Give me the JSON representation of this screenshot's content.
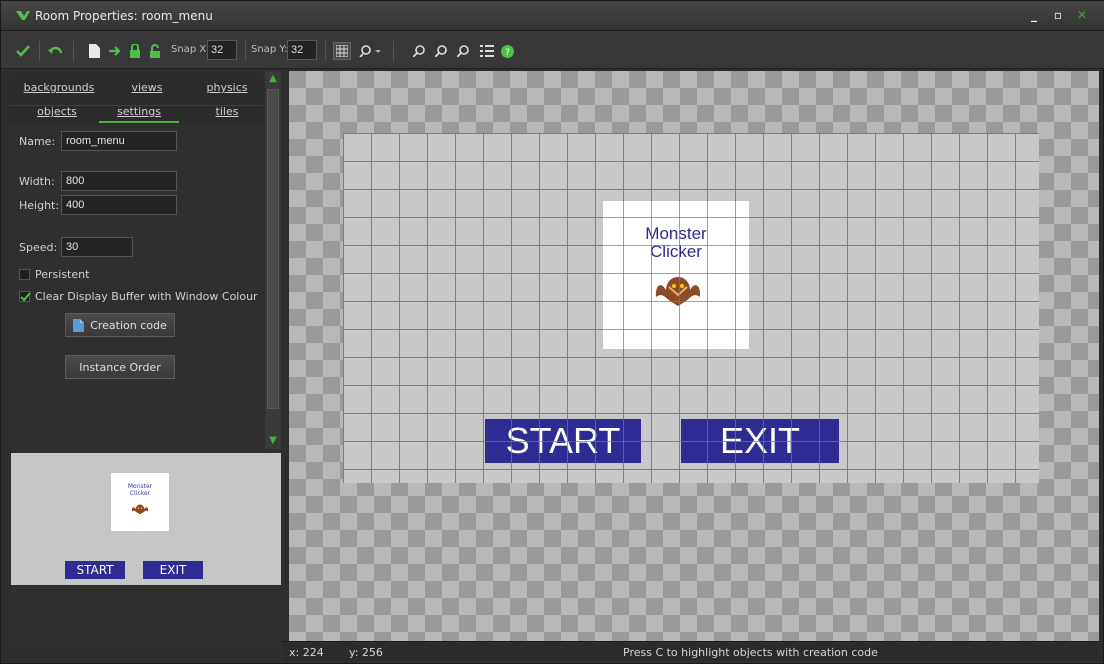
{
  "window": {
    "title": "Room Properties: room_menu",
    "controls": {
      "minimize": "_",
      "maximize": "▫",
      "close": "✕"
    }
  },
  "toolbar": {
    "snap_x_label": "Snap X:",
    "snap_x_value": "32",
    "snap_y_label": "Snap Y:",
    "snap_y_value": "32",
    "icons": [
      "ok-check-icon",
      "undo-icon",
      "new-icon",
      "shift-icon",
      "lock-icon",
      "unlock-icon",
      "grid-icon",
      "zoom-dropdown-icon",
      "zoom-out-icon",
      "zoom-reset-icon",
      "zoom-in-icon",
      "list-icon",
      "help-icon"
    ]
  },
  "tabs": [
    {
      "label": "backgrounds",
      "active": false
    },
    {
      "label": "views",
      "active": false
    },
    {
      "label": "physics",
      "active": false
    },
    {
      "label": "objects",
      "active": false
    },
    {
      "label": "settings",
      "active": true
    },
    {
      "label": "tiles",
      "active": false
    }
  ],
  "settings": {
    "name_label": "Name:",
    "name_value": "room_menu",
    "width_label": "Width:",
    "width_value": "800",
    "height_label": "Height:",
    "height_value": "400",
    "speed_label": "Speed:",
    "speed_value": "30",
    "persistent_label": "Persistent",
    "persistent_checked": false,
    "clear_display_label": "Clear Display Buffer with Window Colour",
    "clear_display_checked": true,
    "creation_code_button": "Creation code",
    "instance_order_button": "Instance Order"
  },
  "preview": {
    "logo_line1": "Monster",
    "logo_line2": "Clicker",
    "start_label": "START",
    "exit_label": "EXIT"
  },
  "room": {
    "logo_line1": "Monster",
    "logo_line2": "Clicker",
    "start_label": "START",
    "exit_label": "EXIT"
  },
  "status": {
    "x": "x: 224",
    "y": "y: 256",
    "message": "Press C to highlight objects with creation code"
  },
  "colors": {
    "accent": "#45b33a",
    "button_blue": "#2e2b92",
    "logo_text": "#2b2b8f"
  }
}
